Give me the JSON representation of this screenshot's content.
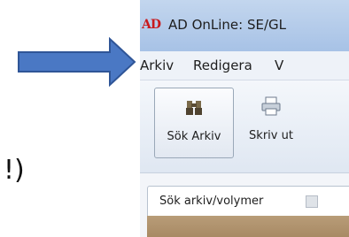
{
  "annotation": {
    "trailing_text": "!)"
  },
  "window": {
    "logo": "AD",
    "title": "AD OnLine: SE/GL"
  },
  "menu": {
    "items": [
      "Arkiv",
      "Redigera",
      "V"
    ]
  },
  "toolbar": {
    "buttons": [
      {
        "label": "Sök Arkiv",
        "icon": "binoculars-icon"
      },
      {
        "label": "Skriv ut",
        "icon": "printer-icon"
      }
    ]
  },
  "tabs": [
    {
      "label": "Sök arkiv/volymer"
    }
  ],
  "colors": {
    "arrow_fill": "#4a78c4",
    "arrow_stroke": "#2f5597",
    "title_bar": "#b4cbea",
    "logo": "#c8191d"
  }
}
